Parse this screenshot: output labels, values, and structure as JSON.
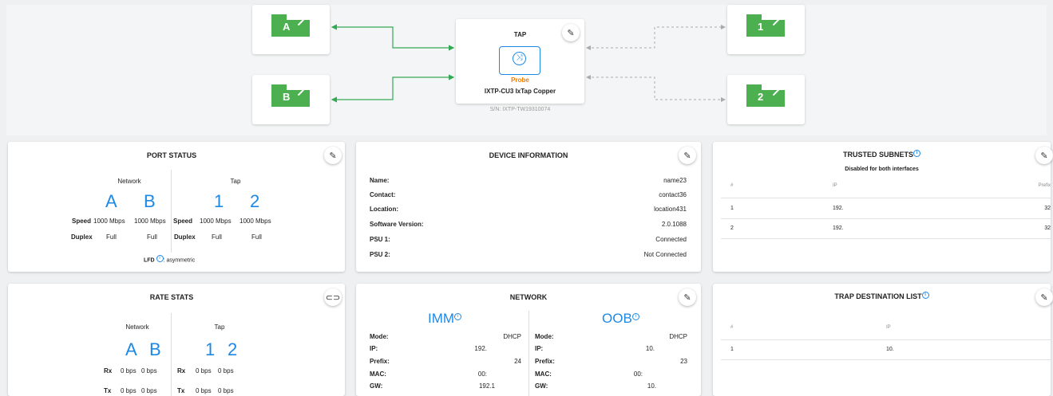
{
  "topology": {
    "port_a": "A",
    "port_b": "B",
    "port_1": "1",
    "port_2": "2",
    "tap": {
      "title": "TAP",
      "mode": "Probe",
      "model": "IXTP-CU3 IxTap Copper",
      "serial": "S/N: IXTP-TW19310074"
    },
    "colors": {
      "link": "#34a853",
      "dashed": "#aaaaaa",
      "port": "#4caf50",
      "accent": "#1e88e5",
      "probe": "#f57c00"
    }
  },
  "port_status": {
    "title": "PORT STATUS",
    "network_label": "Network",
    "tap_label": "Tap",
    "ports": [
      "A",
      "B",
      "1",
      "2"
    ],
    "speed_label": "Speed",
    "duplex_label": "Duplex",
    "speeds": [
      "1000 Mbps",
      "1000 Mbps",
      "1000 Mbps",
      "1000 Mbps"
    ],
    "duplex": [
      "Full",
      "Full",
      "Full",
      "Full"
    ],
    "lfd_label": "LFD",
    "lfd_value": ": asymmetric"
  },
  "device_info": {
    "title": "DEVICE INFORMATION",
    "rows": [
      {
        "label": "Name:",
        "value": "name23"
      },
      {
        "label": "Contact:",
        "value": "contact36"
      },
      {
        "label": "Location:",
        "value": "location431"
      },
      {
        "label": "Software Version:",
        "value": "2.0.1088"
      },
      {
        "label": "PSU 1:",
        "value": "Connected"
      },
      {
        "label": "PSU 2:",
        "value": "Not Connected"
      }
    ]
  },
  "trusted_subnets": {
    "title": "TRUSTED SUBNETS",
    "subtitle": "Disabled for both interfaces",
    "headers": [
      "#",
      "IP",
      "Prefix"
    ],
    "rows": [
      {
        "num": "1",
        "ip": "192.",
        "prefix": "32"
      },
      {
        "num": "2",
        "ip": "192.",
        "prefix": "32"
      }
    ]
  },
  "rate_stats": {
    "title": "RATE STATS",
    "network_label": "Network",
    "tap_label": "Tap",
    "ports": [
      "A",
      "B",
      "1",
      "2"
    ],
    "rx_label": "Rx",
    "tx_label": "Tx",
    "rx": [
      "0 bps",
      "0 bps",
      "0 bps",
      "0 bps"
    ],
    "tx": [
      "0 bps",
      "0 bps",
      "0 bps",
      "0 bps"
    ]
  },
  "network": {
    "title": "NETWORK",
    "imm": {
      "heading": "IMM",
      "rows": [
        {
          "label": "Mode:",
          "value": "DHCP"
        },
        {
          "label": "IP:",
          "value": "192."
        },
        {
          "label": "Prefix:",
          "value": "24"
        },
        {
          "label": "MAC:",
          "value": "00:"
        },
        {
          "label": "GW:",
          "value": "192.1"
        }
      ]
    },
    "oob": {
      "heading": "OOB",
      "rows": [
        {
          "label": "Mode:",
          "value": "DHCP"
        },
        {
          "label": "IP:",
          "value": "10."
        },
        {
          "label": "Prefix:",
          "value": "23"
        },
        {
          "label": "MAC:",
          "value": "00:"
        },
        {
          "label": "GW:",
          "value": "10."
        }
      ]
    }
  },
  "trap_destinations": {
    "title": "TRAP DESTINATION LIST",
    "headers": [
      "#",
      "IP"
    ],
    "rows": [
      {
        "num": "1",
        "ip": "10."
      }
    ]
  }
}
